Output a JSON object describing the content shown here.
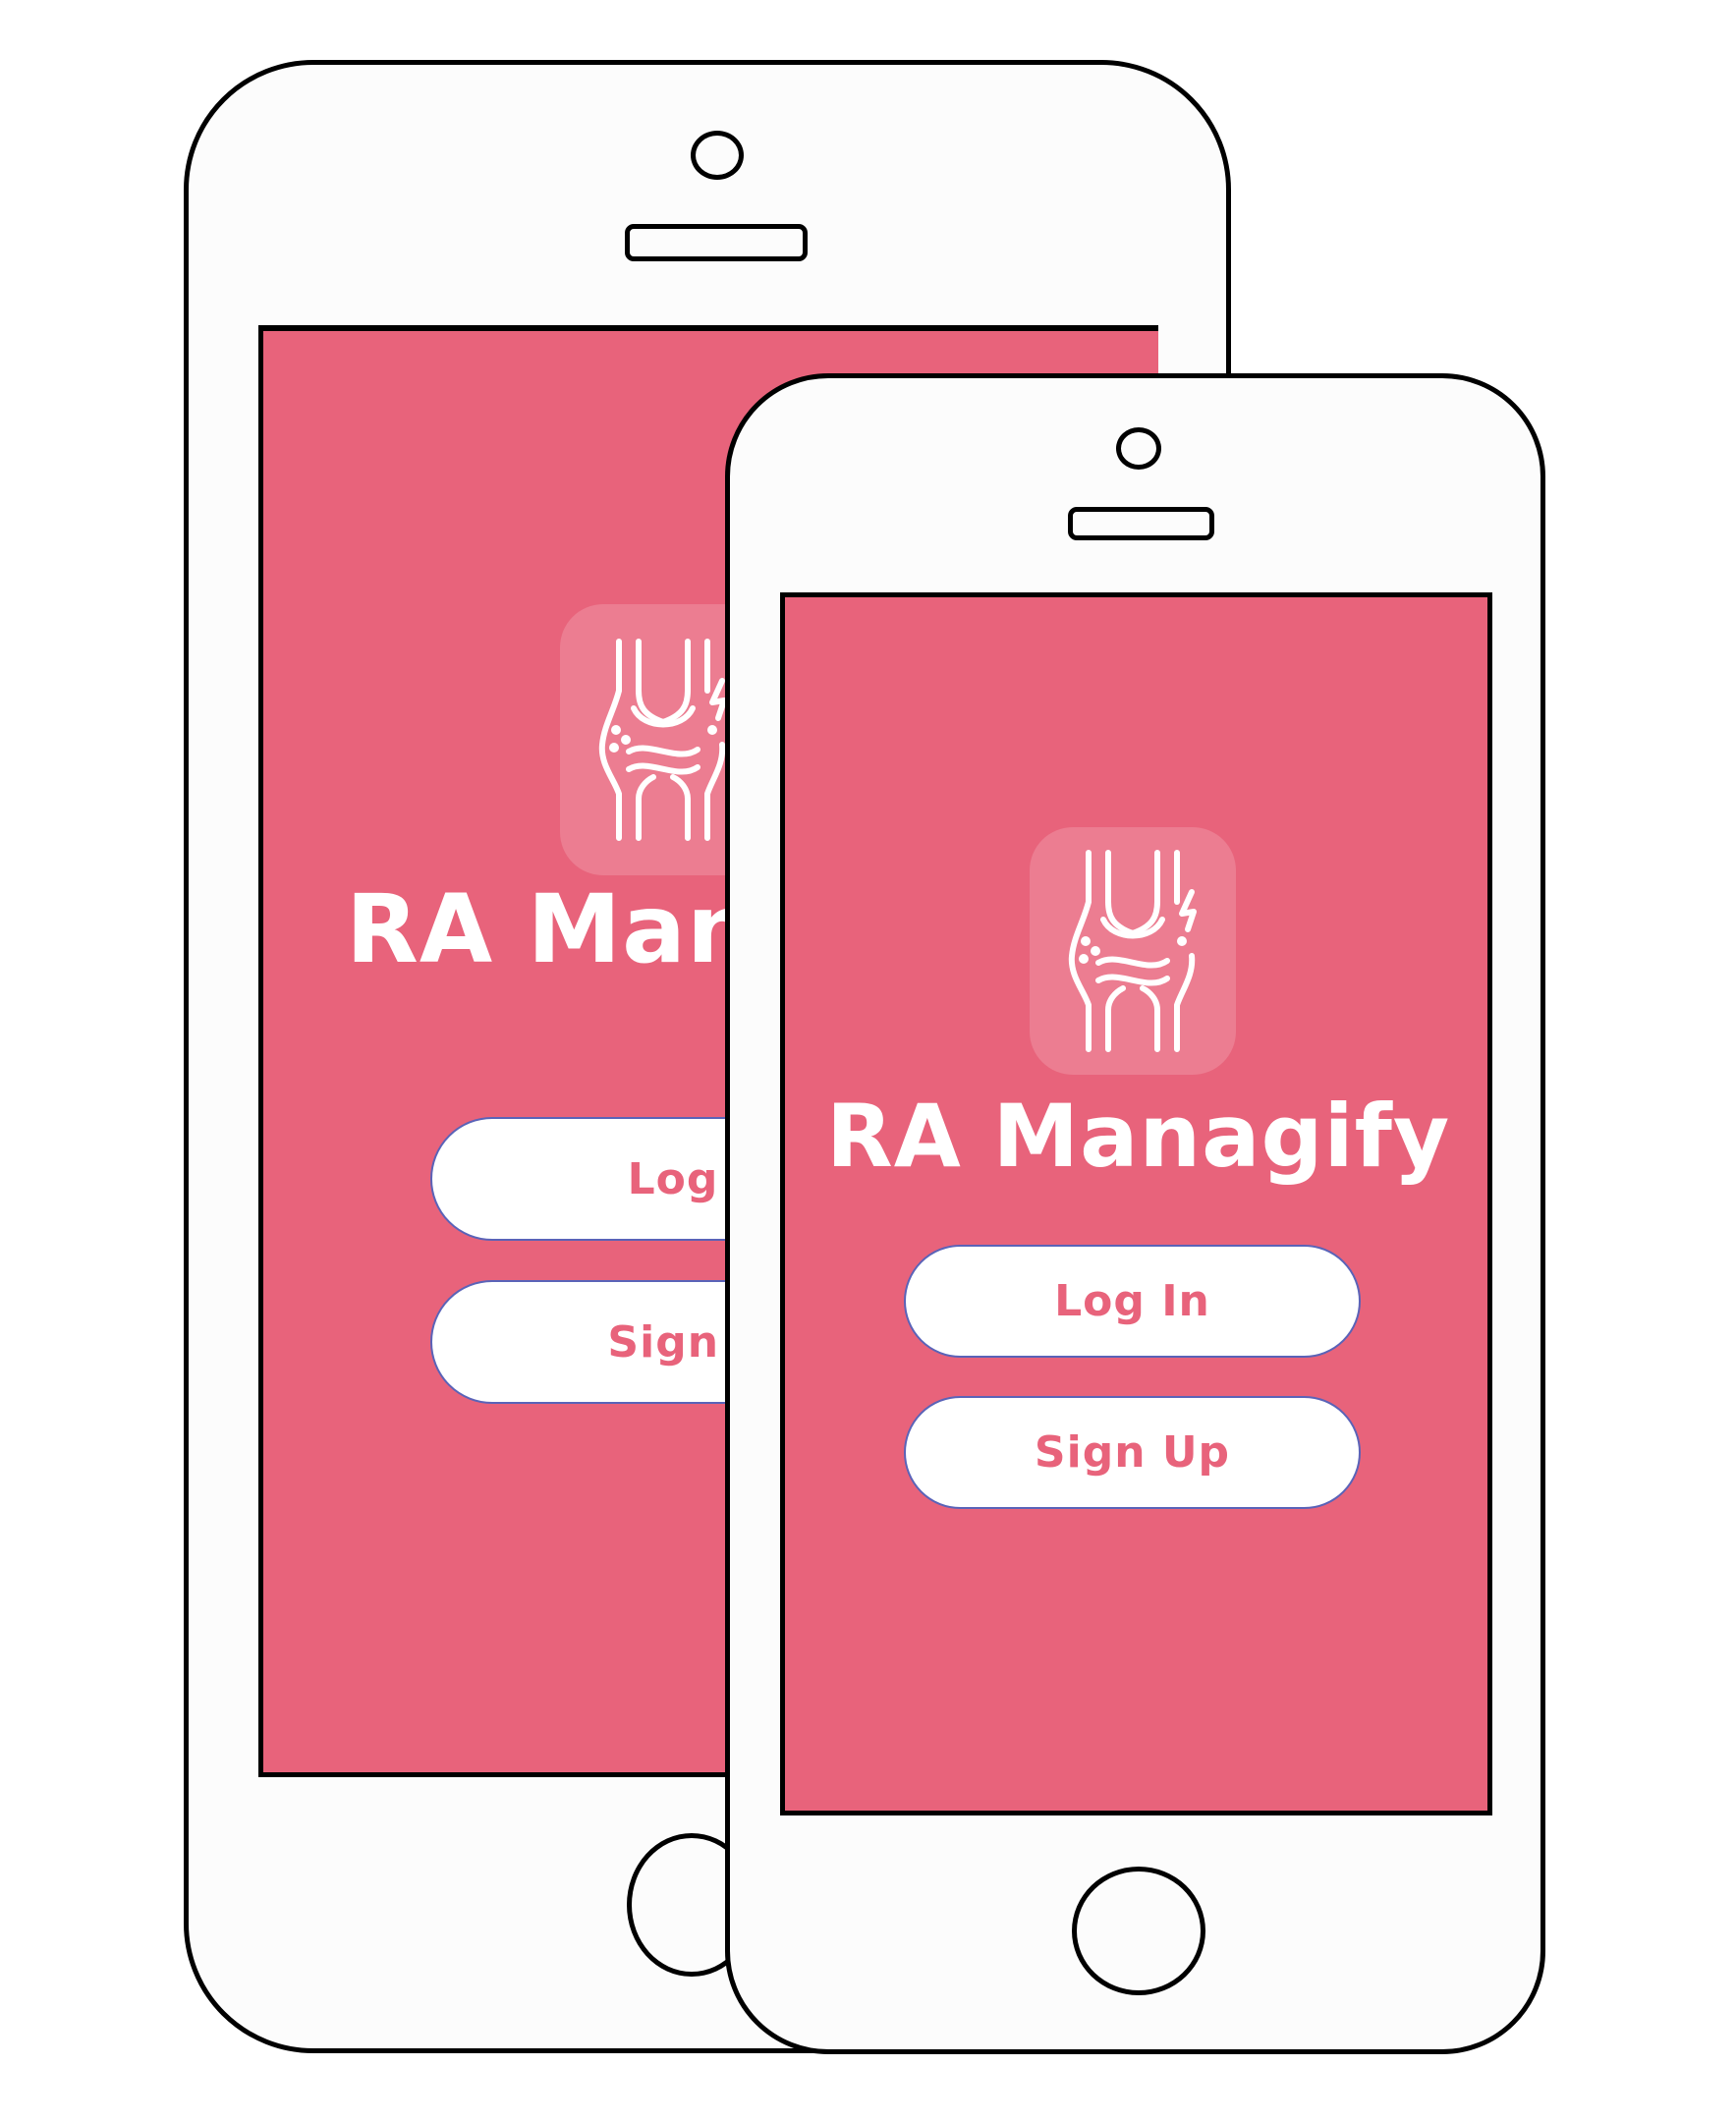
{
  "colors": {
    "screen_background": "#e8637b",
    "button_text": "#e8637b",
    "button_background": "#ffffff",
    "button_border": "#5a63b8",
    "device_outline": "#000000",
    "device_body": "#fcfcfc"
  },
  "app": {
    "title": "RA Managify",
    "icon": "knee-joint-icon"
  },
  "buttons": {
    "login_label": "Log In",
    "signup_label": "Sign Up"
  }
}
